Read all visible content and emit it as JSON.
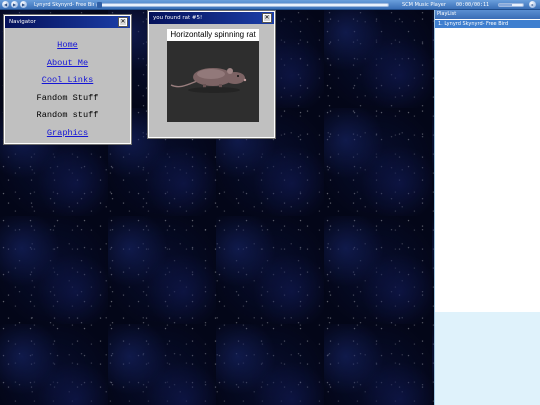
{
  "player": {
    "track_title": "Lynyrd Skynyrd- Free Bird",
    "app_name": "SCM Music Player",
    "time": "00:00/00:11",
    "progress_fraction": 0.0,
    "volume_fraction": 0.55
  },
  "playlist": {
    "title": "PlayList",
    "items": [
      {
        "label": "1. Lynyrd Skynyrd- Free Bird",
        "selected": true
      }
    ]
  },
  "navigator": {
    "title": "Navigator",
    "close_glyph": "✕",
    "items": [
      {
        "label": "Home",
        "link": true
      },
      {
        "label": "About Me",
        "link": true
      },
      {
        "label": "Cool Links",
        "link": true
      },
      {
        "label": "Fandom Stuff",
        "link": false
      },
      {
        "label": "Random stuff",
        "link": false
      },
      {
        "label": "Graphics",
        "link": true
      }
    ]
  },
  "rat_window": {
    "title": "you found rat #5!",
    "close_glyph": "✕",
    "caption": "Horizontally spinning rat",
    "image_icon": "spinning-rat-image"
  },
  "colors": {
    "titlebar_start": "#05115a",
    "titlebar_end": "#1b3ea8",
    "window_face": "#c0c0c0",
    "link": "#1414d6",
    "player_bar": "#3a6fb7",
    "playlist_selected": "#3f7fcf",
    "desktop": "#030618"
  }
}
